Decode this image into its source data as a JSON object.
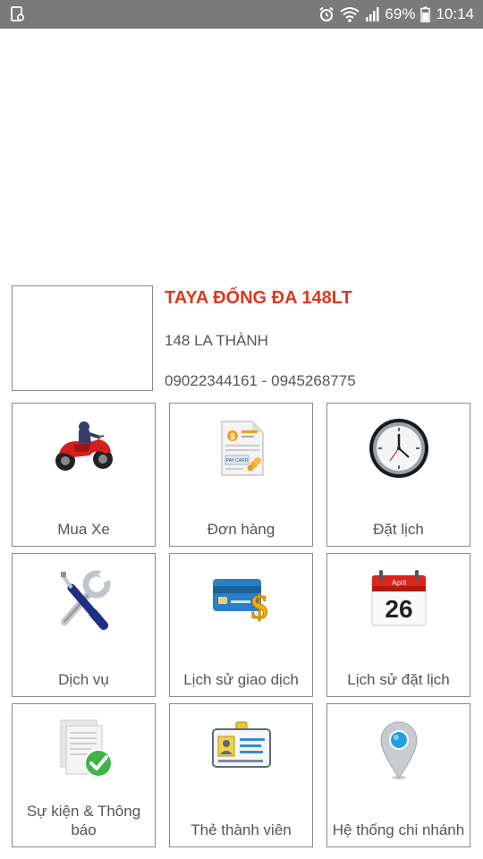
{
  "status_bar": {
    "battery": "69%",
    "time": "10:14"
  },
  "store": {
    "name": "TAYA ĐỐNG ĐA 148LT",
    "address": "148 LA THÀNH",
    "phone": "09022344161 - 0945268775"
  },
  "menu": [
    {
      "label": "Mua Xe",
      "icon": "motorbike-icon"
    },
    {
      "label": "Đơn hàng",
      "icon": "invoice-icon"
    },
    {
      "label": "Đặt lịch",
      "icon": "clock-icon"
    },
    {
      "label": "Dịch vụ",
      "icon": "tools-icon"
    },
    {
      "label": "Lịch sử giao dịch",
      "icon": "credit-card-icon"
    },
    {
      "label": "Lịch sử đặt lịch",
      "icon": "calendar-icon"
    },
    {
      "label": "Sự kiện & Thông báo",
      "icon": "document-check-icon"
    },
    {
      "label": "Thẻ thành viên",
      "icon": "id-badge-icon"
    },
    {
      "label": "Hệ thống chi nhánh",
      "icon": "map-pin-icon"
    }
  ],
  "calendar_icon": {
    "month": "April",
    "day": "26"
  },
  "invoice_icon": {
    "text": "PAY CARD"
  },
  "colors": {
    "accent": "#e0381d",
    "status_bar": "#7a7a7a",
    "border": "#8a8a8a"
  }
}
